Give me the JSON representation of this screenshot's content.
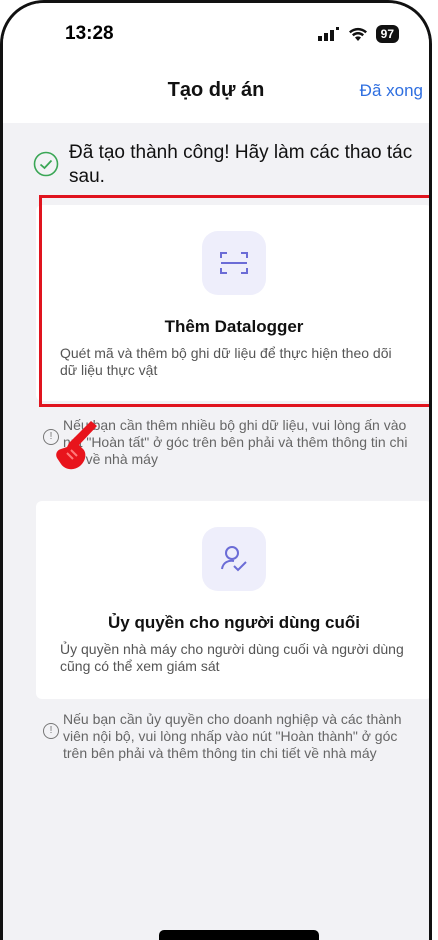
{
  "status_bar": {
    "time": "13:28",
    "battery": "97"
  },
  "nav": {
    "title": "Tạo dự án",
    "done_label": "Đã xong"
  },
  "success_message": "Đã tạo thành công! Hãy làm các thao tác sau.",
  "card_datalogger": {
    "title": "Thêm Datalogger",
    "description": "Quét mã và thêm bộ ghi dữ liệu để thực hiện theo dõi dữ liệu thực vật",
    "icon": "scan-icon"
  },
  "note_datalogger": "Nếu bạn cần thêm nhiều bộ ghi dữ liệu, vui lòng ấn vào nút \"Hoàn tất\" ở góc trên bên phải và thêm thông tin chi tiết về nhà máy",
  "card_authorize": {
    "title": "Ủy quyền cho người dùng cuối",
    "description": "Ủy quyền nhà máy cho người dùng cuối và người dùng cũng có thể xem giám sát",
    "icon": "user-check-icon"
  },
  "note_authorize": "Nếu bạn cần ủy quyền cho doanh nghiệp và các thành viên nội bộ, vui lòng nhấp vào nút \"Hoàn thành\" ở góc trên bên phải và thêm thông tin chi tiết về nhà máy",
  "colors": {
    "accent": "#2f6fe0",
    "success": "#3aa655",
    "highlight": "#e0141e"
  }
}
